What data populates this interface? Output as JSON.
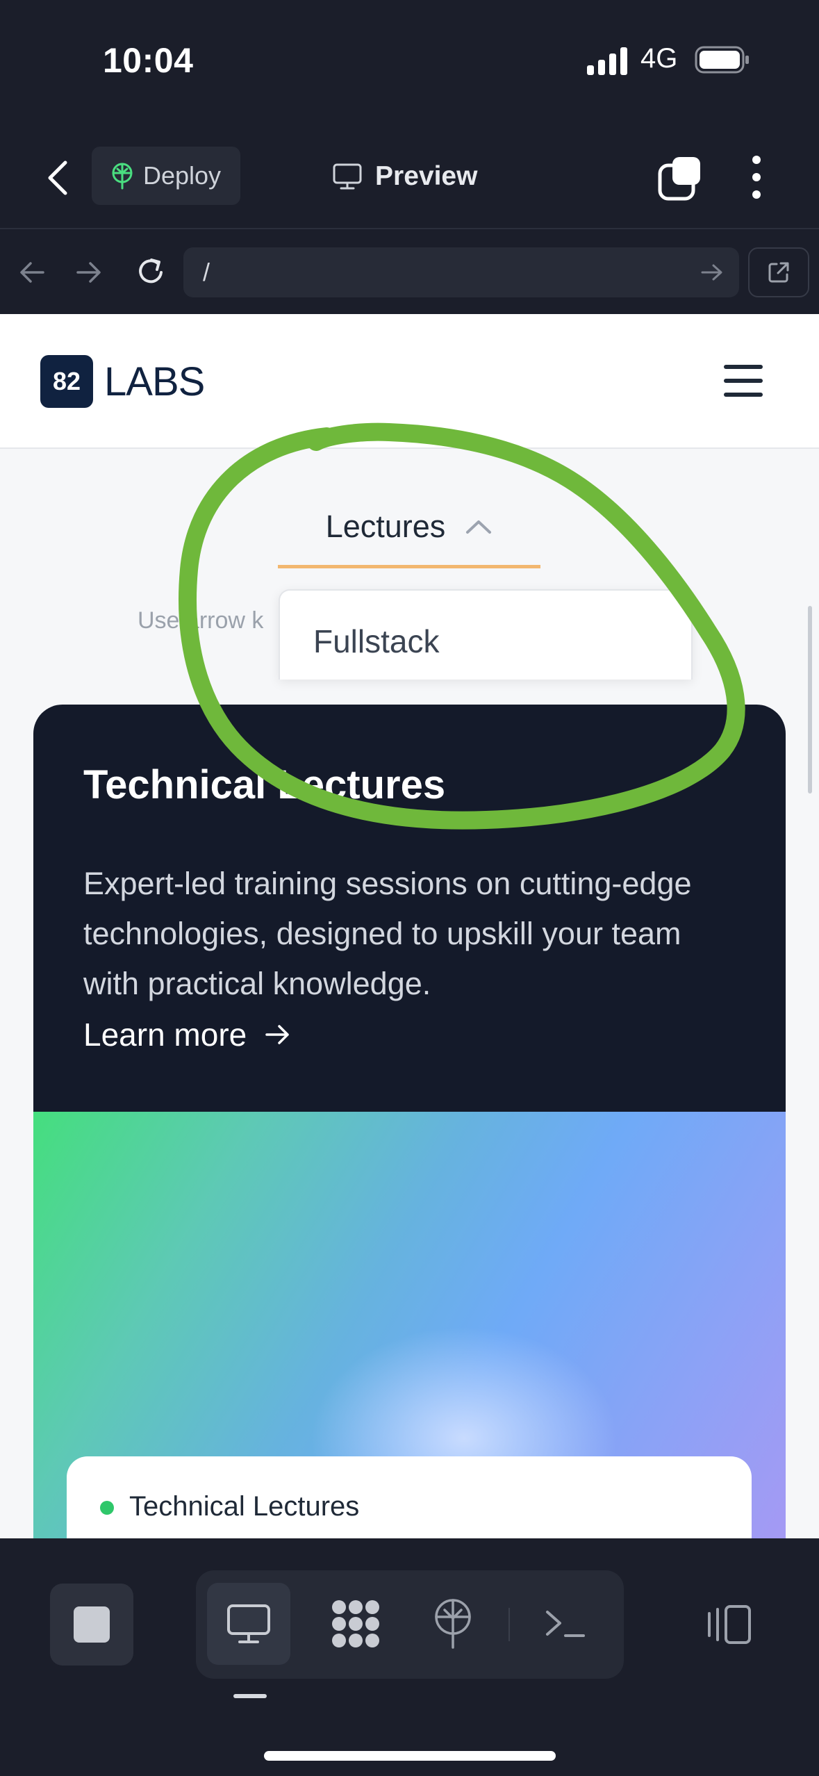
{
  "status_bar": {
    "time": "10:04",
    "network": "4G",
    "signal_icon": "signal-bars-icon",
    "battery_icon": "battery-icon"
  },
  "app_toolbar": {
    "back_icon": "chevron-left-icon",
    "deploy_label": "Deploy",
    "deploy_icon": "globe-tree-icon",
    "preview_label": "Preview",
    "preview_icon": "monitor-icon",
    "tabs_icon": "tabs-icon",
    "more_icon": "more-vertical-icon"
  },
  "url_bar": {
    "value": "/",
    "icons": [
      "arrow-left-icon",
      "arrow-right-icon",
      "reload-icon",
      "go-arrow-icon",
      "external-link-icon"
    ]
  },
  "site": {
    "logo_badge": "82",
    "logo_text": "LABS",
    "menu_icon": "hamburger-icon",
    "nav_tab": "Lectures",
    "hint": "Use arrow k",
    "dropdown_items": [
      "Fullstack"
    ],
    "card": {
      "title": "Technical Lectures",
      "description": "Expert-led training sessions on cutting-edge technologies, designed to upskill your team with practical knowledge.",
      "cta": "Learn more",
      "inner_title": "Technical Lectures"
    }
  },
  "colors": {
    "app_bg": "#1b1e2a",
    "card_bg": "#141a2a",
    "tab_underline": "#f2b770",
    "annotation": "#6fb83b",
    "logo_bg": "#102240"
  },
  "bottom_bar": {
    "stop_icon": "stop-icon",
    "modes": [
      "monitor-icon",
      "modules-icon",
      "deploy-icon",
      "terminal-icon"
    ],
    "panel_icon": "panel-toggle-icon"
  }
}
